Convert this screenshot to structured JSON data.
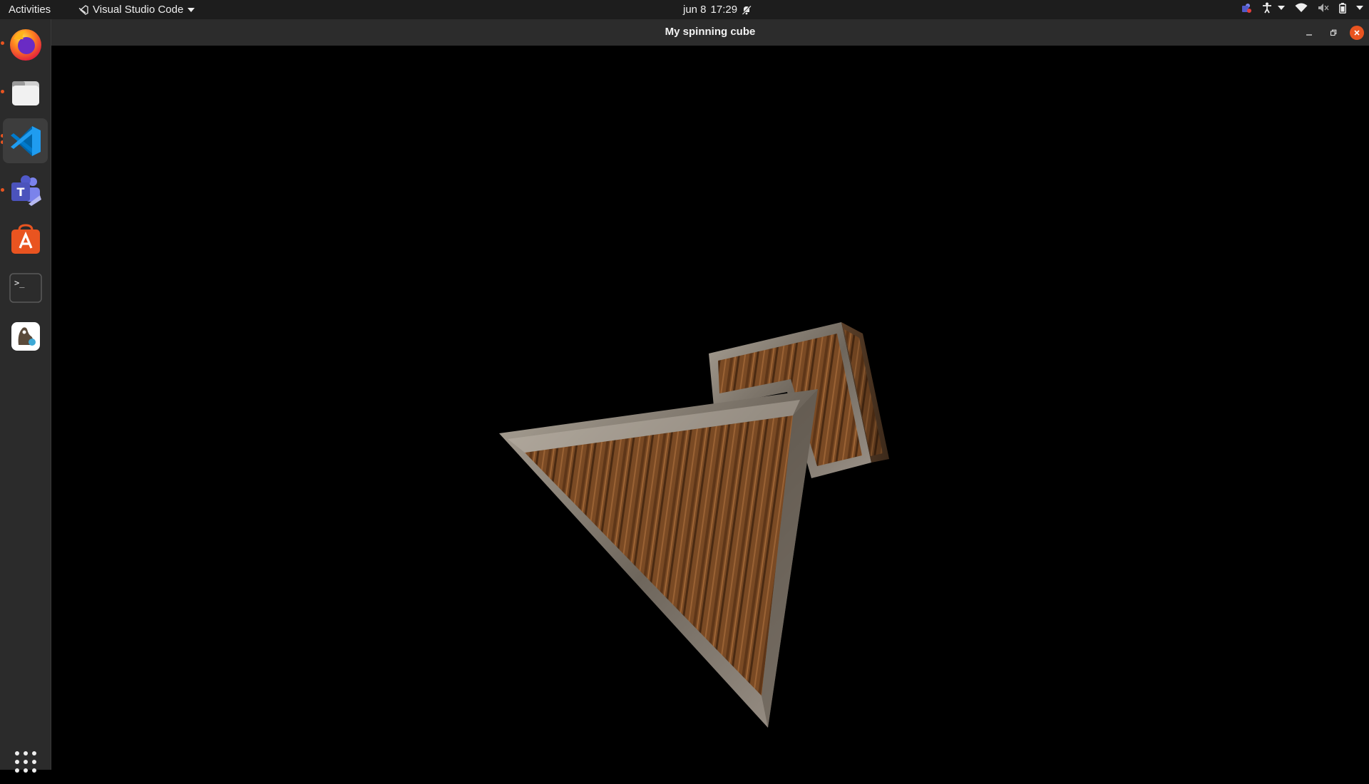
{
  "topbar": {
    "activities_label": "Activities",
    "app_name": "Visual Studio Code",
    "date": "jun 8",
    "time": "17:29"
  },
  "dock": {
    "items": [
      {
        "name": "firefox",
        "icon": "firefox-icon",
        "running": true
      },
      {
        "name": "files",
        "icon": "files-icon",
        "running": true
      },
      {
        "name": "vscode",
        "icon": "vscode-icon",
        "running": true,
        "active": true
      },
      {
        "name": "teams",
        "icon": "teams-icon",
        "running": true
      },
      {
        "name": "software",
        "icon": "app-store-icon",
        "running": false
      },
      {
        "name": "terminal",
        "icon": "terminal-icon",
        "running": false
      },
      {
        "name": "gimp",
        "icon": "gimp-icon",
        "running": false
      }
    ],
    "terminal_prompt": ">_"
  },
  "window": {
    "title": "My spinning cube"
  },
  "colors": {
    "accent": "#e95420",
    "topbar_bg": "#1d1d1d",
    "dock_bg": "#2b2b2b",
    "titlebar_bg": "#2c2c2c",
    "wood": "#7a4a24",
    "metal_frame": "#8d8478"
  }
}
